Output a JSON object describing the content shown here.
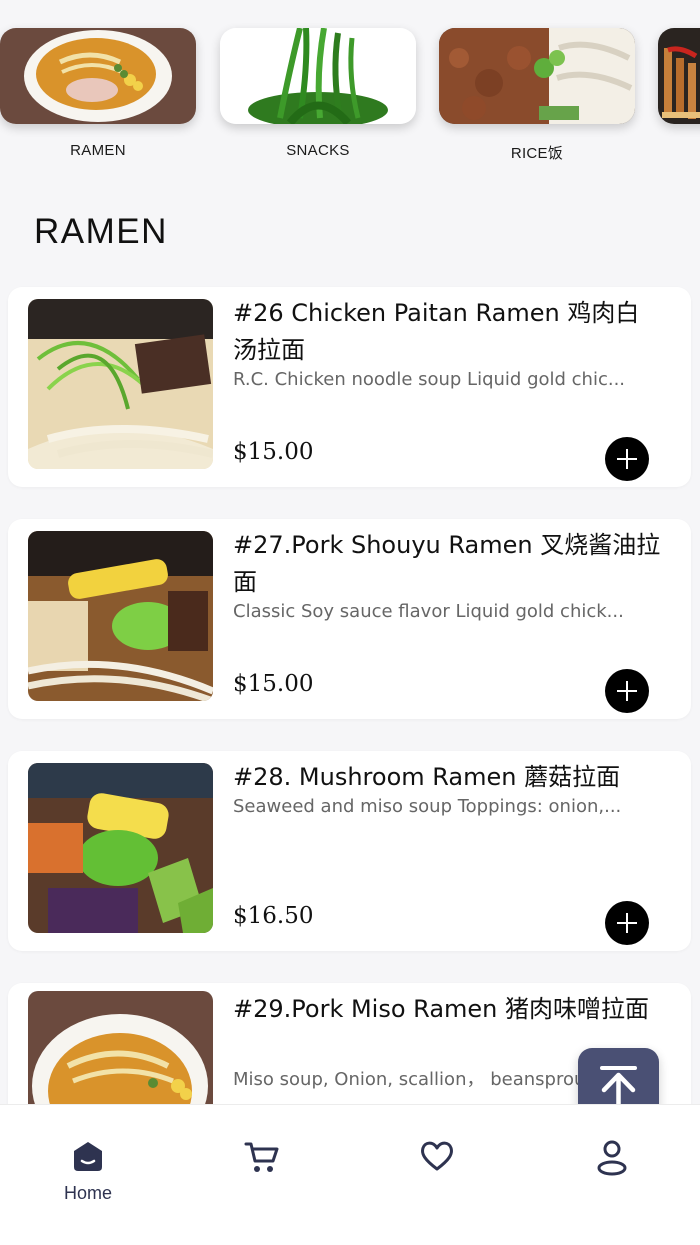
{
  "categories": [
    {
      "label": "RAMEN",
      "icon": "ramen-bowl-photo"
    },
    {
      "label": "SNACKS",
      "icon": "seaweed-salad-photo"
    },
    {
      "label": "RICE饭",
      "icon": "rice-bowl-photo"
    },
    {
      "label": "",
      "icon": "skewers-photo"
    }
  ],
  "section": {
    "title": "RAMEN"
  },
  "menu_items": [
    {
      "name": "#26 Chicken Paitan Ramen 鸡肉白汤拉面",
      "description": "R.C. Chicken noodle soup Liquid gold chic...",
      "price": "$15.00"
    },
    {
      "name": "#27.Pork Shouyu Ramen 叉烧酱油拉面",
      "description": "Classic Soy sauce flavor Liquid gold chick...",
      "price": "$15.00"
    },
    {
      "name": "#28. Mushroom Ramen 蘑菇拉面",
      "description": "Seaweed and miso soup Toppings: onion,...",
      "price": "$16.50"
    },
    {
      "name": "#29.Pork Miso Ramen 猪肉味噌拉面",
      "description": "Miso soup, Onion, scallion， beansprouts...",
      "price": ""
    }
  ],
  "bottom_nav": {
    "home_label": "Home",
    "icons": [
      "home-icon",
      "cart-icon",
      "heart-icon",
      "profile-icon"
    ]
  },
  "colors": {
    "accent": "#2e3350",
    "scroll_top_bg": "#4a5074",
    "add_button": "#000000",
    "background": "#f6f6f8"
  }
}
